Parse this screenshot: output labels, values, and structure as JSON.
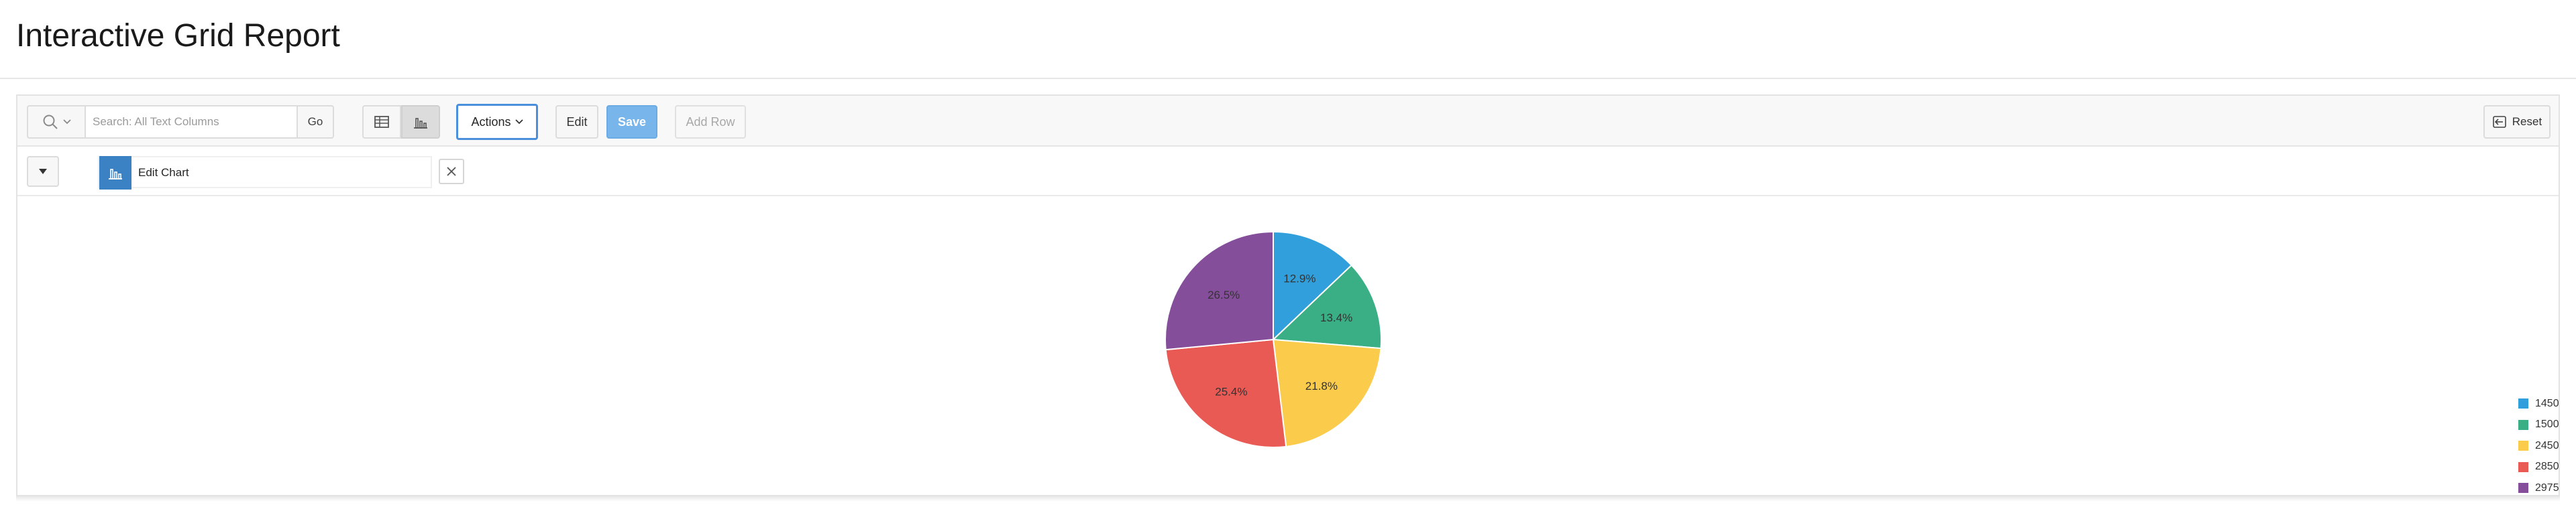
{
  "page": {
    "title": "Interactive Grid Report"
  },
  "toolbar": {
    "search_placeholder": "Search: All Text Columns",
    "go_label": "Go",
    "actions_label": "Actions",
    "edit_label": "Edit",
    "save_label": "Save",
    "add_row_label": "Add Row",
    "reset_label": "Reset",
    "view_mode": "chart"
  },
  "chart_panel": {
    "edit_chart_label": "Edit Chart"
  },
  "colors": {
    "accent": "#4a8fdb",
    "save_button": "#77b5ea",
    "chart_icon_bg": "#3b82c4"
  },
  "chart_data": {
    "type": "pie",
    "title": "",
    "categories": [
      "1450",
      "1500",
      "2450",
      "2850",
      "2975"
    ],
    "values": [
      12.9,
      13.4,
      21.8,
      25.4,
      26.5
    ],
    "labels": [
      "12.9%",
      "13.4%",
      "21.8%",
      "25.4%",
      "26.5%"
    ],
    "colors": [
      "#309fdb",
      "#3aaf85",
      "#fbcb4b",
      "#ea5a55",
      "#854e9b"
    ],
    "legend_position": "right",
    "start_angle": "12 o'clock",
    "direction": "clockwise"
  }
}
